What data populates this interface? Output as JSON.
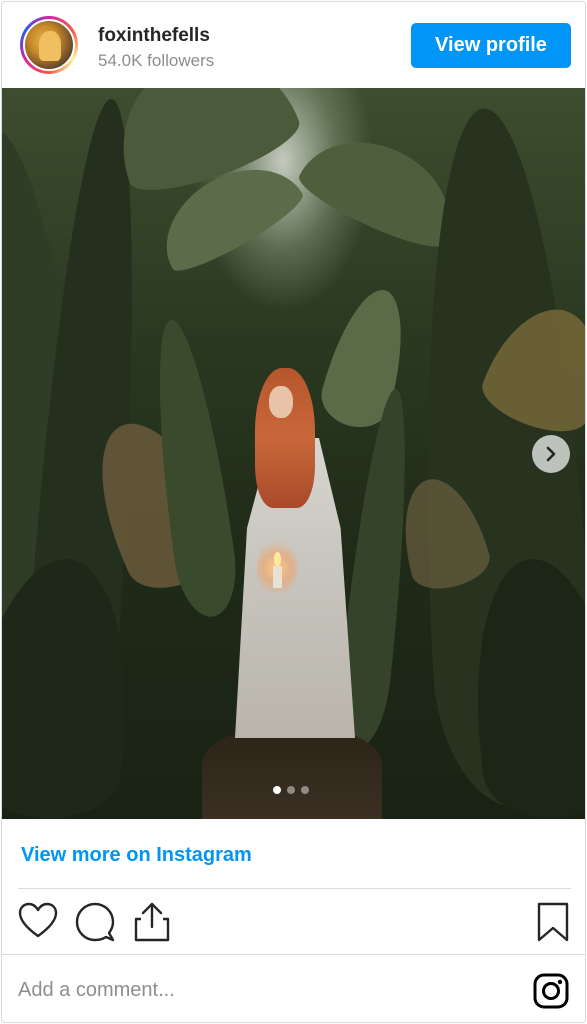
{
  "header": {
    "username": "foxinthefells",
    "followers": "54.0K followers",
    "view_profile_label": "View profile"
  },
  "photo": {
    "carousel_dots_total": 3,
    "carousel_active_index": 0
  },
  "footer": {
    "view_more_label": "View more on Instagram",
    "comment_placeholder": "Add a comment..."
  },
  "colors": {
    "accent": "#0095f6",
    "text": "#262626",
    "muted": "#8e8e8e",
    "border": "#dbdbdb"
  },
  "icons": {
    "like": "heart-icon",
    "comment": "comment-icon",
    "share": "share-icon",
    "save": "bookmark-icon",
    "instagram": "instagram-icon",
    "next": "chevron-right-icon"
  }
}
